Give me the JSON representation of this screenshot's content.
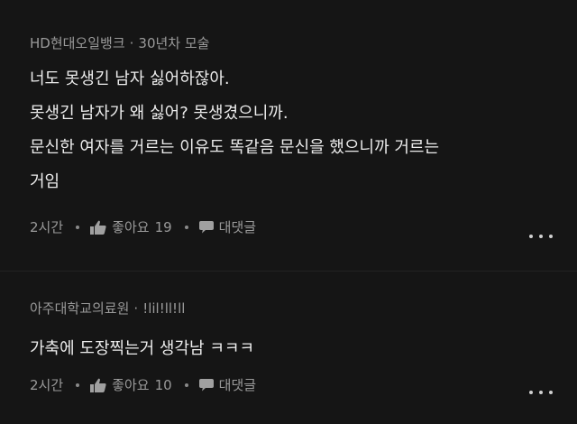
{
  "comments": [
    {
      "author": "HD현대오일뱅크",
      "tenure": "30년차 모술",
      "lines": [
        "너도 못생긴 남자 싫어하잖아.",
        "못생긴 남자가 왜 싫어? 못생겼으니까.",
        "문신한 여자를 거르는 이유도 똑같음 문신을 했으니까 거르는",
        "거임"
      ],
      "time": "2시간",
      "like_label": "좋아요",
      "like_count": "19",
      "reply_label": "대댓글"
    },
    {
      "author": "아주대학교의료원",
      "tenure": "!lil!ll!ll",
      "lines": [
        "가축에 도장찍는거 생각남 ㅋㅋㅋ"
      ],
      "time": "2시간",
      "like_label": "좋아요",
      "like_count": "10",
      "reply_label": "대댓글"
    }
  ],
  "icons": {
    "like": "thumbs-up-icon",
    "reply": "speech-bubble-icon",
    "more": "more-horizontal-icon"
  },
  "colors": {
    "background": "#151515",
    "text": "#ececec",
    "meta": "#9a9a9a"
  }
}
